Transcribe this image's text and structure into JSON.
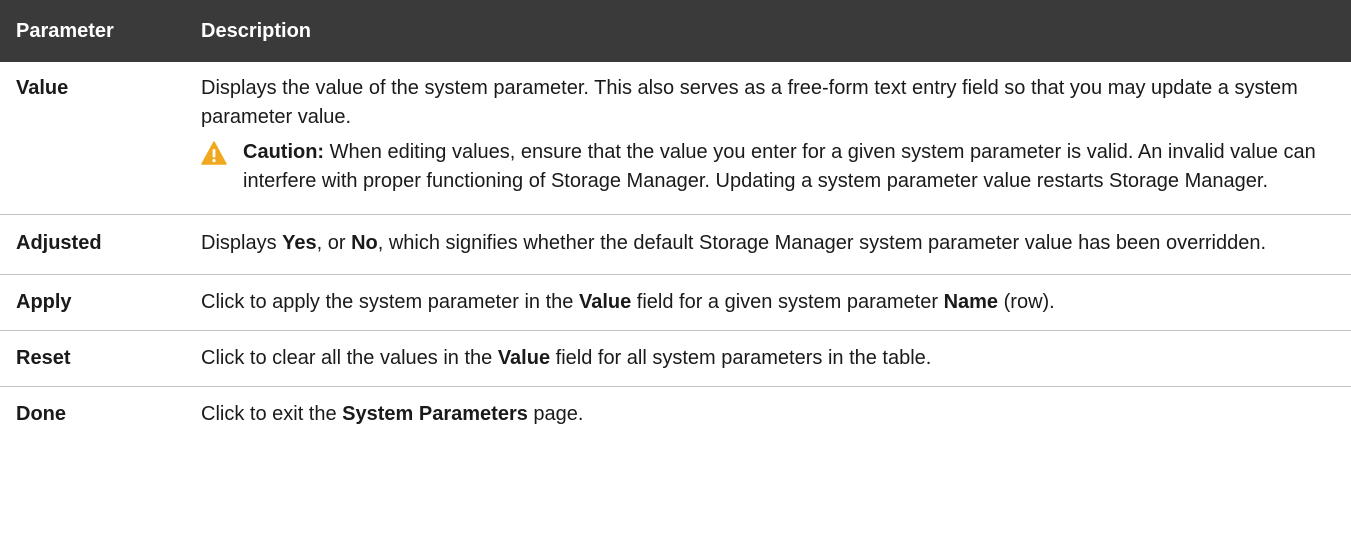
{
  "header": {
    "col1": "Parameter",
    "col2": "Description"
  },
  "rows": [
    {
      "name": "Value",
      "desc": "Displays the value of the system parameter. This also serves as a free-form text entry field so that you may update a system parameter value.",
      "caution_label": "Caution:",
      "caution_text": "When editing values, ensure that the value you enter for a given system parameter is valid. An invalid value can interfere with proper functioning of Storage Manager. Updating a system parameter value restarts Storage Manager.",
      "caution_icon": "warning-triangle-icon",
      "caution_color": "#f0a81e"
    },
    {
      "name": "Adjusted",
      "desc_pre": "Displays ",
      "desc_b1": "Yes",
      "desc_mid": ", or ",
      "desc_b2": "No",
      "desc_post": ", which signifies whether the default Storage Manager system parameter value has been overridden."
    },
    {
      "name": "Apply",
      "desc_pre": "Click to apply the system parameter in the ",
      "desc_b1": "Value",
      "desc_mid": " field for a given system parameter ",
      "desc_b2": "Name",
      "desc_post": " (row)."
    },
    {
      "name": "Reset",
      "desc_pre": "Click to clear all the values in the ",
      "desc_b1": "Value",
      "desc_post": " field for all system parameters in the table."
    },
    {
      "name": "Done",
      "desc_pre": "Click to exit the ",
      "desc_b1": "System Parameters",
      "desc_post": " page."
    }
  ],
  "colors": {
    "header_bg": "#3a3a3a",
    "header_text": "#ffffff",
    "row_divider": "#c4c4c4"
  }
}
